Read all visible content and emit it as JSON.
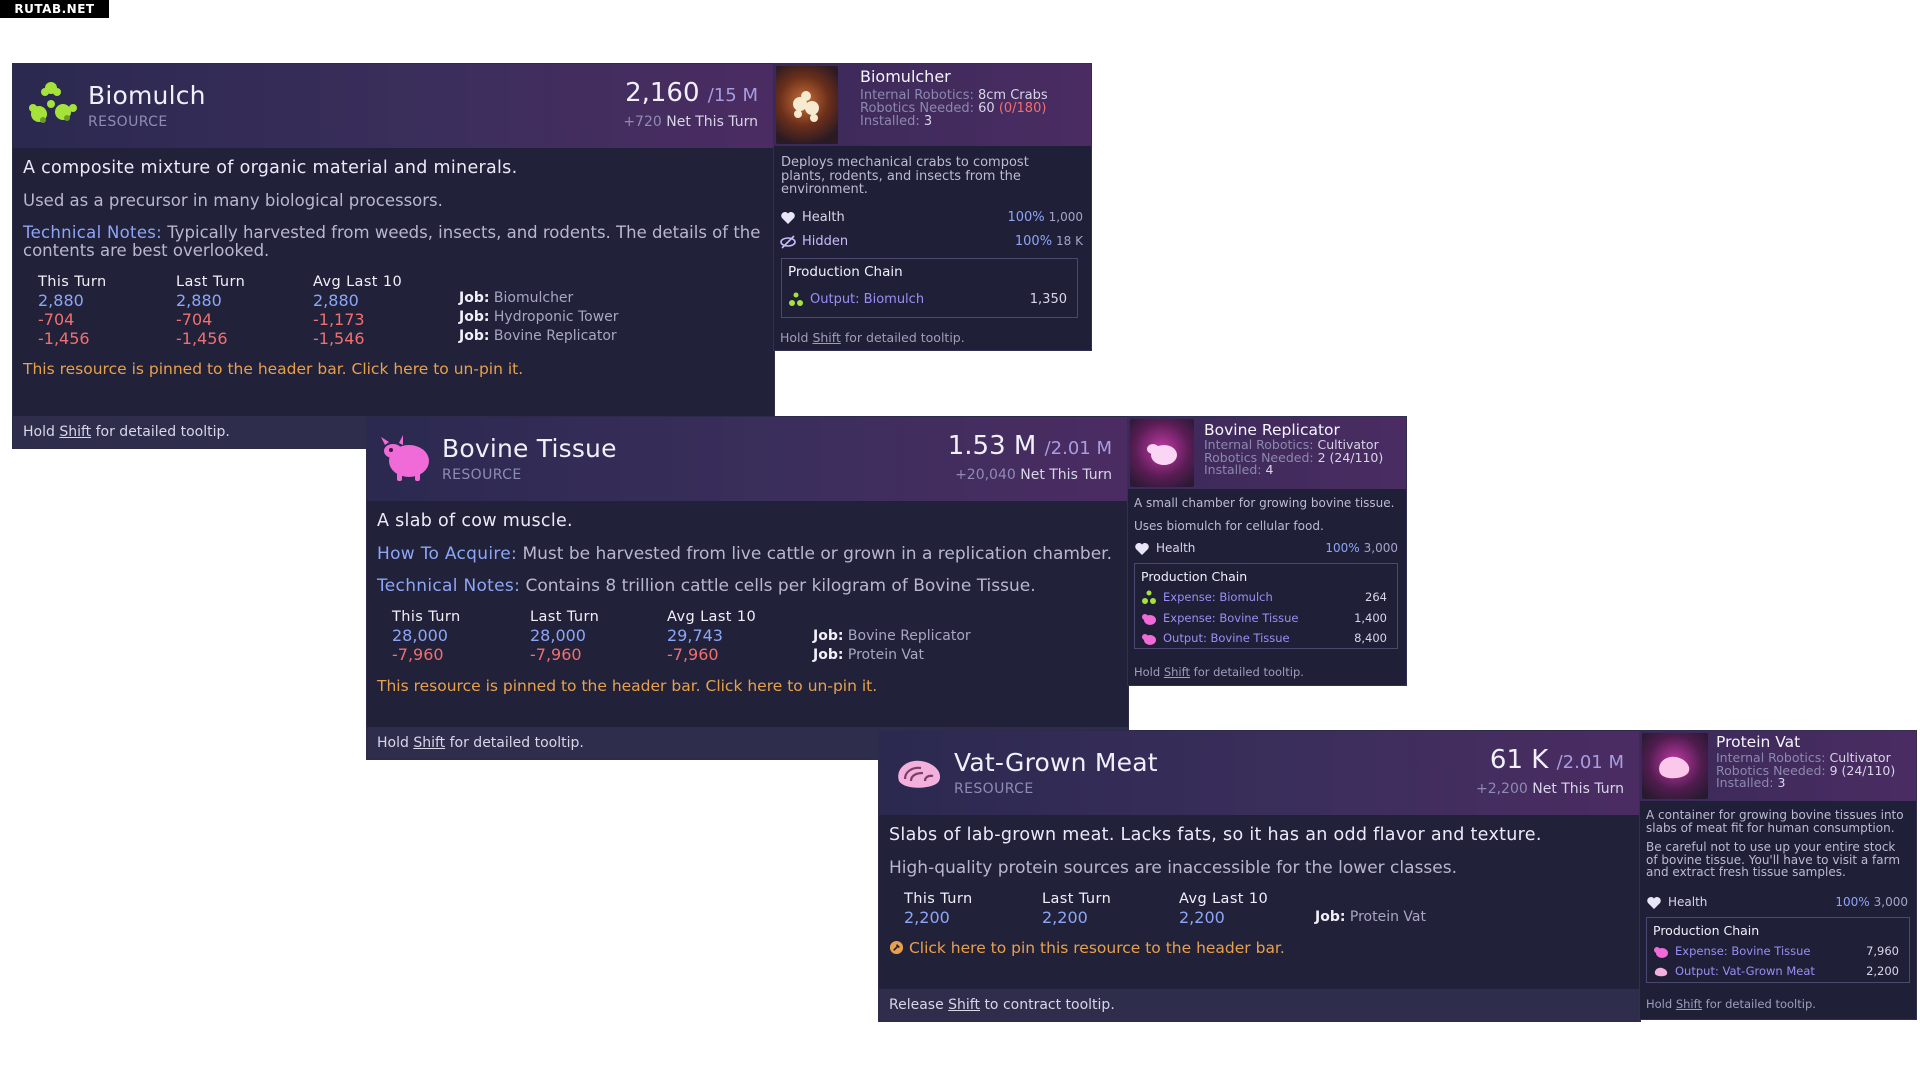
{
  "watermark": "RUTAB.NET",
  "biomulch": {
    "title": "Biomulch",
    "type": "RESOURCE",
    "amount": "2,160",
    "cap": "/15 M",
    "net_value": "+720",
    "net_label": "Net This Turn",
    "lead": "A composite mixture of organic material and minerals.",
    "para1": "Used as a precursor in many biological processors.",
    "notes_key": "Technical Notes:",
    "notes_text": "Typically harvested from weeds, insects, and rodents. The details of the contents are best overlooked.",
    "stats_headers": [
      "This Turn",
      "Last Turn",
      "Avg Last 10"
    ],
    "this_turn": [
      "2,880",
      "-704",
      "-1,456"
    ],
    "last_turn": [
      "2,880",
      "-704",
      "-1,456"
    ],
    "avg_last_10": [
      "2,880",
      "-1,173",
      "-1,546"
    ],
    "job_key": "Job:",
    "jobs": [
      "Biomulcher",
      "Hydroponic Tower",
      "Bovine Replicator"
    ],
    "pin_text": "This resource is pinned to the header bar. Click here to un-pin it.",
    "footer_pre": "Hold",
    "footer_key": "Shift",
    "footer_post": "for detailed tooltip.",
    "icon": "biomulch-icon",
    "icon_color": "#9be33a"
  },
  "biomulcher": {
    "title": "Biomulcher",
    "robotics_label": "Internal Robotics:",
    "robotics_value": "8cm Crabs",
    "needed_label": "Robotics Needed:",
    "needed_value": "60",
    "needed_extra": "(0/180)",
    "installed_label": "Installed:",
    "installed_value": "3",
    "description": "Deploys mechanical crabs to compost plants, rodents, and insects from the environment.",
    "stat1_label": "Health",
    "stat1_pct": "100%",
    "stat1_val": "1,000",
    "stat2_label": "Hidden",
    "stat2_pct": "100%",
    "stat2_val": "18 K",
    "chain_title": "Production Chain",
    "chain": [
      {
        "label": "Output: Biomulch",
        "value": "1,350"
      }
    ],
    "footer_pre": "Hold",
    "footer_key": "Shift",
    "footer_post": "for detailed tooltip."
  },
  "bovine": {
    "title": "Bovine Tissue",
    "type": "RESOURCE",
    "amount": "1.53 M",
    "cap": "/2.01 M",
    "net_value": "+20,040",
    "net_label": "Net This Turn",
    "lead": "A slab of cow muscle.",
    "acquire_key": "How To Acquire:",
    "acquire_text": "Must be harvested from live cattle or grown in a replication chamber.",
    "notes_key": "Technical Notes:",
    "notes_text": "Contains 8 trillion cattle cells per kilogram of Bovine Tissue.",
    "stats_headers": [
      "This Turn",
      "Last Turn",
      "Avg Last 10"
    ],
    "this_turn": [
      "28,000",
      "-7,960"
    ],
    "last_turn": [
      "28,000",
      "-7,960"
    ],
    "avg_last_10": [
      "29,743",
      "-7,960"
    ],
    "job_key": "Job:",
    "jobs": [
      "Bovine Replicator",
      "Protein Vat"
    ],
    "pin_text": "This resource is pinned to the header bar. Click here to un-pin it.",
    "footer_pre": "Hold",
    "footer_key": "Shift",
    "footer_post": "for detailed tooltip.",
    "icon": "cow-icon",
    "icon_color": "#f06bd8"
  },
  "replicator": {
    "title": "Bovine Replicator",
    "robotics_label": "Internal Robotics:",
    "robotics_value": "Cultivator",
    "needed_label": "Robotics Needed:",
    "needed_value": "2",
    "needed_extra": "(24/110)",
    "installed_label": "Installed:",
    "installed_value": "4",
    "desc1": "A small chamber for growing bovine tissue.",
    "desc2": "Uses biomulch for cellular food.",
    "stat1_label": "Health",
    "stat1_pct": "100%",
    "stat1_val": "3,000",
    "chain_title": "Production Chain",
    "chain": [
      {
        "label": "Expense: Biomulch",
        "value": "264"
      },
      {
        "label": "Expense: Bovine Tissue",
        "value": "1,400"
      },
      {
        "label": "Output: Bovine Tissue",
        "value": "8,400"
      }
    ],
    "footer_pre": "Hold",
    "footer_key": "Shift",
    "footer_post": "for detailed tooltip."
  },
  "vat": {
    "title": "Vat-Grown Meat",
    "type": "RESOURCE",
    "amount": "61 K",
    "cap": "/2.01 M",
    "net_value": "+2,200",
    "net_label": "Net This Turn",
    "lead": "Slabs of lab-grown meat. Lacks fats, so it has an odd flavor and texture.",
    "para1": "High-quality protein sources are inaccessible for the lower classes.",
    "stats_headers": [
      "This Turn",
      "Last Turn",
      "Avg Last 10"
    ],
    "this_turn": [
      "2,200"
    ],
    "last_turn": [
      "2,200"
    ],
    "avg_last_10": [
      "2,200"
    ],
    "job_key": "Job:",
    "jobs": [
      "Protein Vat"
    ],
    "pin_text": "Click here to pin this resource to the header bar.",
    "footer_pre": "Release",
    "footer_key": "Shift",
    "footer_post": "to contract tooltip.",
    "icon": "meat-icon",
    "icon_color": "#f0a8d8"
  },
  "protein_vat": {
    "title": "Protein Vat",
    "robotics_label": "Internal Robotics:",
    "robotics_value": "Cultivator",
    "needed_label": "Robotics Needed:",
    "needed_value": "9",
    "needed_extra": "(24/110)",
    "installed_label": "Installed:",
    "installed_value": "3",
    "desc1": "A container for growing bovine tissues into slabs of meat fit for human consumption.",
    "desc2": "Be careful not to use up your entire stock of bovine tissue. You'll have to visit a farm and extract fresh tissue samples.",
    "stat1_label": "Health",
    "stat1_pct": "100%",
    "stat1_val": "3,000",
    "chain_title": "Production Chain",
    "chain": [
      {
        "label": "Expense: Bovine Tissue",
        "value": "7,960"
      },
      {
        "label": "Output: Vat-Grown Meat",
        "value": "2,200"
      }
    ],
    "footer_pre": "Hold",
    "footer_key": "Shift",
    "footer_post": "for detailed tooltip."
  }
}
